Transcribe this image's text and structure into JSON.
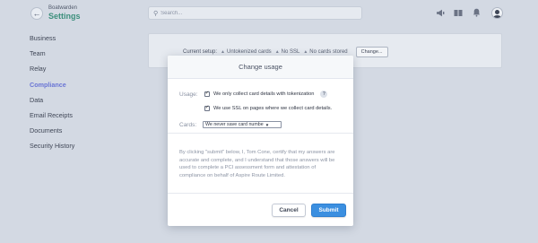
{
  "header": {
    "account_name": "Boatwarden",
    "app_title": "Settings",
    "search_placeholder": "Search..."
  },
  "icons": {
    "back": "arrow-left-icon",
    "search": "search-icon",
    "announcements": "megaphone-icon",
    "docs": "book-icon",
    "notifications": "bell-icon",
    "profile": "user-avatar-icon"
  },
  "sidebar": {
    "items": [
      {
        "label": "Business"
      },
      {
        "label": "Team"
      },
      {
        "label": "Relay"
      },
      {
        "label": "Compliance",
        "active": true
      },
      {
        "label": "Data"
      },
      {
        "label": "Email Receipts"
      },
      {
        "label": "Documents"
      },
      {
        "label": "Security History"
      }
    ]
  },
  "setup": {
    "label": "Current setup:",
    "tags": [
      "Untokenized cards",
      "No SSL",
      "No cards stored"
    ],
    "change_label": "Change..."
  },
  "modal": {
    "title": "Change usage",
    "usage_label": "Usage:",
    "usage_options": [
      {
        "label": "We only collect card details with tokenization",
        "checked": true
      },
      {
        "label": "We use SSL on pages where we collect card details.",
        "checked": true
      }
    ],
    "help_glyph": "?",
    "cards_label": "Cards:",
    "cards_value": "We never save card numbe",
    "disclaimer": "By clicking \"submit\" below, I, Tom Cone, certify that my answers are accurate and complete, and I understand that those answers will be used to complete a PCI assessment form and attestation of compliance on behalf of Aspire Route Limited.",
    "cancel_label": "Cancel",
    "submit_label": "Submit"
  },
  "colors": {
    "accent_green": "#3c8f7c",
    "active_nav": "#6a75d5",
    "primary_button": "#3b8fe0"
  }
}
